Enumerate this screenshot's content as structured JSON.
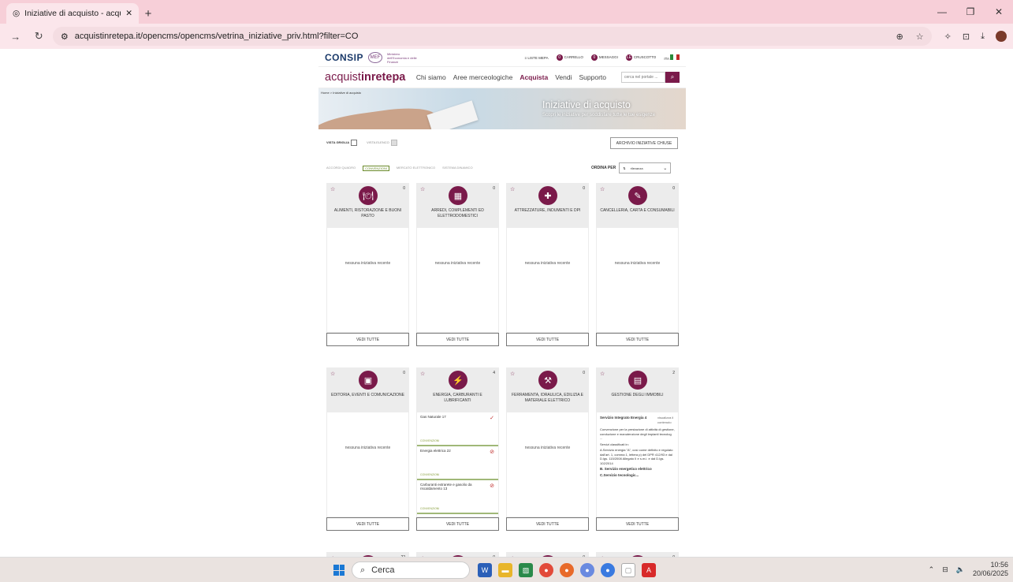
{
  "browser": {
    "tab_title": "Iniziative di acquisto - acquistin",
    "tab_close": "✕",
    "new_tab": "+",
    "url": "acquistinretepa.it/opencms/opencms/vetrina_iniziative_priv.html?filter=CO"
  },
  "site": {
    "consip": "CONSIP",
    "mef": "MEF",
    "mef_text": "Ministero dell'Economia e delle Finanze",
    "top_links": [
      "LISTE MEPA",
      "CARRELLO",
      "MESSAGGI",
      "CRUSCOTTO",
      "ITA"
    ],
    "badges": [
      "0",
      "0",
      "LE"
    ],
    "logo_a": "acquist",
    "logo_b": "inrete",
    "logo_c": "pa",
    "menu": [
      "Chi siamo",
      "Aree merceologiche",
      "Acquista",
      "Vendi",
      "Supporto"
    ],
    "search_placeholder": "cerca nel portale ...",
    "breadcrumb": "Home  >  Iniziative di acquisto",
    "hero_title": "Iniziative di acquisto",
    "hero_subtitle": "Scopri le iniziative per soddisfare tutte le tue esigenze",
    "vista_griglia": "VISTA GRIGLIA",
    "vista_elenco": "VISTA ELENCO",
    "archivio": "ARCHIVIO INIZIATIVE CHIUSE",
    "filters": [
      "ACCORDI QUADRO",
      "CONVENZIONI",
      "MERCATO ELETTRONICO",
      "SISTEMA DINAMICO"
    ],
    "ordina_per": "ORDINA PER",
    "ordina_value": "rilevanza"
  },
  "cards": [
    {
      "title": "ALIMENTI, RISTORAZIONE E BUONI PASTO",
      "count": "0",
      "empty": "nessuna iniziativa recente",
      "button": "VEDI TUTTE",
      "icon": "food-icon"
    },
    {
      "title": "ARREDI, COMPLEMENTI ED ELETTRODOMESTICI",
      "count": "0",
      "empty": "nessuna iniziativa recente",
      "button": "VEDI TUTTE",
      "icon": "furniture-icon"
    },
    {
      "title": "ATTREZZATURE, INDUMENTI E DPI",
      "count": "0",
      "empty": "nessuna iniziativa recente",
      "button": "VEDI TUTTE",
      "icon": "equipment-icon"
    },
    {
      "title": "CANCELLERIA, CARTA E CONSUMABILI",
      "count": "0",
      "empty": "nessuna iniziativa recente",
      "button": "VEDI TUTTE",
      "icon": "stationery-icon"
    },
    {
      "title": "EDITORIA, EVENTI E COMUNICAZIONE",
      "count": "0",
      "empty": "nessuna iniziativa recente",
      "button": "VEDI TUTTE",
      "icon": "media-icon"
    },
    {
      "title": "ENERGIA, CARBURANTI E LUBRIFICANTI",
      "count": "4",
      "button": "VEDI TUTTE",
      "icon": "energy-icon",
      "items": [
        {
          "name": "Gas Naturale 17",
          "type": "CONVENZIONI"
        },
        {
          "name": "Energia elettrica 22",
          "type": "CONVENZIONI"
        },
        {
          "name": "Carburanti extrarete e gasolio da riscaldamento 13",
          "type": "CONVENZIONI"
        }
      ]
    },
    {
      "title": "FERRAMENTA, IDRAULICA, EDILIZIA E MATERIALE ELETTRICO",
      "count": "0",
      "empty": "nessuna iniziativa recente",
      "button": "VEDI TUTTE",
      "icon": "hardware-icon"
    },
    {
      "title": "GESTIONE DEGLI IMMOBILI",
      "count": "2",
      "button": "VEDI TUTTE",
      "icon": "building-icon",
      "gest": {
        "name": "Servizio Integrato Energia 4",
        "img_alt": "visualizza il contenuto",
        "desc": "Convenzione per la prestazione di attività di gestione, conduzione e manutenzione degli impianti tecnolog ...",
        "classif": "Servizi classificati in:",
        "a": "A.Servizio energia \"A\", così come definito e regolato dall'art. 1, comma 1, lettera p) del DPR 412/93 e dal D.lgs. 115/2008 Allegato II e s.m.i. e dal D.lgs. 102/2014",
        "b": "B. Servizio energetico elettrico",
        "c": "C.Servizio tecnologic..."
      }
    }
  ],
  "taskbar": {
    "search": "Cerca",
    "time": "10:56",
    "date": "20/06/2025"
  }
}
